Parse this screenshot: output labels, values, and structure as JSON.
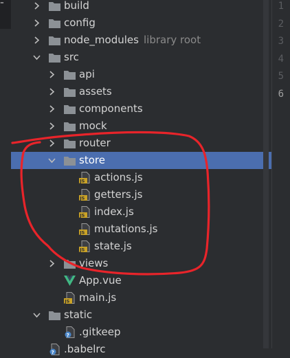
{
  "tree": {
    "rows": [
      {
        "label": "build",
        "hint": "",
        "icon": "folder-icon",
        "state": "collapsed"
      },
      {
        "label": "config",
        "hint": "",
        "icon": "folder-icon",
        "state": "collapsed"
      },
      {
        "label": "node_modules",
        "hint": "library root",
        "icon": "folder-icon",
        "state": "collapsed"
      },
      {
        "label": "src",
        "hint": "",
        "icon": "folder-icon",
        "state": "expanded"
      },
      {
        "label": "api",
        "hint": "",
        "icon": "folder-icon",
        "state": "collapsed"
      },
      {
        "label": "assets",
        "hint": "",
        "icon": "folder-icon",
        "state": "collapsed"
      },
      {
        "label": "components",
        "hint": "",
        "icon": "folder-icon",
        "state": "collapsed"
      },
      {
        "label": "mock",
        "hint": "",
        "icon": "folder-icon",
        "state": "collapsed"
      },
      {
        "label": "router",
        "hint": "",
        "icon": "folder-icon",
        "state": "collapsed"
      },
      {
        "label": "store",
        "hint": "",
        "icon": "folder-icon",
        "state": "expanded",
        "selected": true
      },
      {
        "label": "actions.js",
        "hint": "",
        "icon": "js-file-icon",
        "state": "file"
      },
      {
        "label": "getters.js",
        "hint": "",
        "icon": "js-file-icon",
        "state": "file"
      },
      {
        "label": "index.js",
        "hint": "",
        "icon": "js-file-icon",
        "state": "file"
      },
      {
        "label": "mutations.js",
        "hint": "",
        "icon": "js-file-icon",
        "state": "file"
      },
      {
        "label": "state.js",
        "hint": "",
        "icon": "js-file-icon",
        "state": "file"
      },
      {
        "label": "views",
        "hint": "",
        "icon": "folder-icon",
        "state": "collapsed"
      },
      {
        "label": "App.vue",
        "hint": "",
        "icon": "vue-file-icon",
        "state": "file"
      },
      {
        "label": "main.js",
        "hint": "",
        "icon": "js-file-icon",
        "state": "file"
      },
      {
        "label": "static",
        "hint": "",
        "icon": "folder-icon",
        "state": "expanded"
      },
      {
        "label": ".gitkeep",
        "hint": "",
        "icon": "unknown-file-icon",
        "state": "file"
      },
      {
        "label": ".babelrc",
        "hint": "",
        "icon": "unknown-file-icon",
        "state": "file"
      }
    ]
  },
  "gutter": {
    "line_numbers": [
      "1",
      "2",
      "3",
      "4",
      "5",
      "6"
    ],
    "active_line": "6"
  },
  "corner": {
    "mark": "⁼"
  },
  "colors": {
    "background": "#2b2d30",
    "selection": "#4b6eaf",
    "folder": "#8c9196",
    "js_badge": "#c9a227",
    "vue": "#41b883",
    "annotation": "#e8242a"
  }
}
